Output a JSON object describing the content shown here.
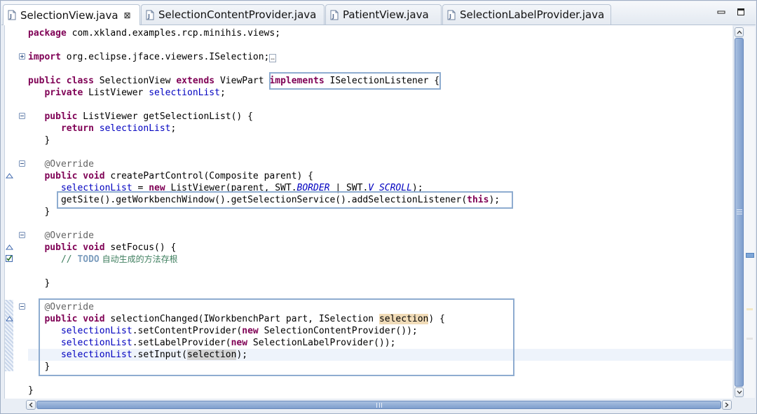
{
  "tabs": [
    {
      "label": "SelectionView.java",
      "active": true,
      "closable": true
    },
    {
      "label": "SelectionContentProvider.java",
      "active": false
    },
    {
      "label": "PatientView.java",
      "active": false
    },
    {
      "label": "SelectionLabelProvider.java",
      "active": false
    }
  ],
  "window_controls": {
    "minimize": "minimize-icon",
    "maximize": "maximize-icon"
  },
  "code": {
    "package_kw": "package",
    "package_name": " com.xkland.examples.rcp.minihis.views;",
    "import_kw": "import",
    "import_name": " org.eclipse.jface.viewers.ISelection;",
    "import_fold_marker": "…",
    "class_public": "public",
    "class_kw": "class",
    "class_name": " SelectionView ",
    "extends_kw": "extends",
    "extends_name": " ViewPart ",
    "implements_kw": "implements",
    "implements_name": " ISelectionListener",
    "open_brace": " {",
    "field_private": "private",
    "field_type": " ListViewer ",
    "field_name": "selectionList",
    "semicolon": ";",
    "getter_public": "public",
    "getter_sig": " ListViewer getSelectionList() {",
    "return_kw": "return",
    "return_field": "selectionList",
    "close_brace": "}",
    "override": "@Override",
    "void_kw": "void",
    "create_sig": " createPartControl(Composite parent) {",
    "assign_field": "selectionList",
    "assign_mid": " = ",
    "new_kw": "new",
    "assign_rest": " ListViewer(parent, SWT.",
    "border_const": "BORDER",
    "pipe_swt": " | SWT.",
    "vscroll_const": "V_SCROLL",
    "assign_end": ");",
    "getsite_pre": "getSite().getWorkbenchWindow().getSelectionService().addSelectionListener(",
    "this_kw": "this",
    "getsite_end": ");",
    "setfocus_sig": " setFocus() {",
    "todo_prefix": "// ",
    "todo_tag": "TODO",
    "todo_text": " 自动生成的方法存根",
    "changed_sig_pre": " selectionChanged(IWorkbenchPart part, ISelection ",
    "changed_param": "selection",
    "changed_sig_end": ") {",
    "l1_field": "selectionList",
    "l1_mid": ".setContentProvider(",
    "l1_new": "new",
    "l1_end": " SelectionContentProvider());",
    "l2_field": "selectionList",
    "l2_mid": ".setLabelProvider(",
    "l2_new": "new",
    "l2_end": " SelectionLabelProvider());",
    "l3_field": "selectionList",
    "l3_mid": ".setInput(",
    "l3_param": "selection",
    "l3_end": ");"
  }
}
